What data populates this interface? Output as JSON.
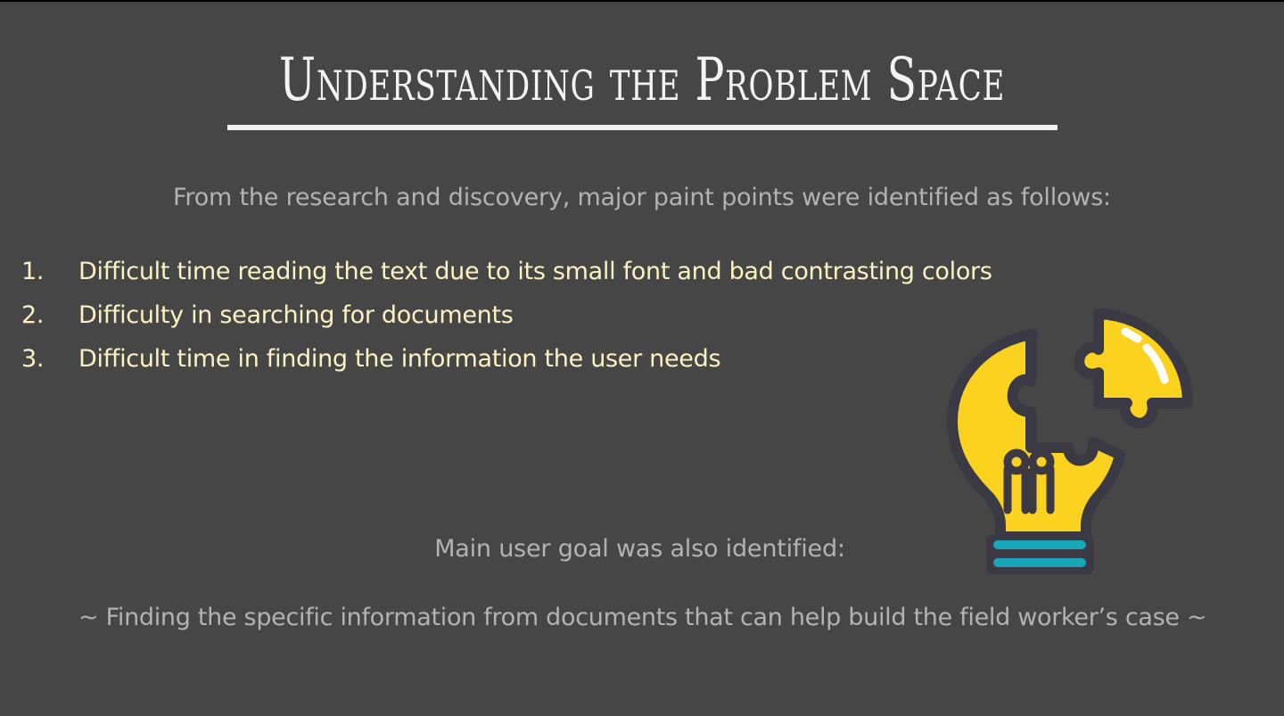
{
  "slide": {
    "title": "Understanding the Problem Space",
    "intro": "From the research and discovery, major paint points were identified as follows:",
    "pain_points": [
      {
        "number": "1.",
        "text": "Difficult time reading the text due to its small font and bad contrasting colors"
      },
      {
        "number": "2.",
        "text": "Difficulty in searching for documents"
      },
      {
        "number": "3.",
        "text": "Difficult time in finding the information the user needs"
      }
    ],
    "goal_heading": "Main user goal was also identified:",
    "goal_statement": "~ Finding the specific information from documents that can help build the field worker’s case ~",
    "illustration": {
      "icon": "lightbulb-puzzle-icon",
      "colors": {
        "bulb": "#fbd21f",
        "outline": "#3b3a44",
        "base_stripes": "#1aa5b9",
        "highlight": "#ffffff"
      }
    },
    "colors": {
      "background": "#464646",
      "title": "#f4f4f4",
      "body_text": "#b3b3b3",
      "list_text": "#fdf2c3"
    }
  }
}
